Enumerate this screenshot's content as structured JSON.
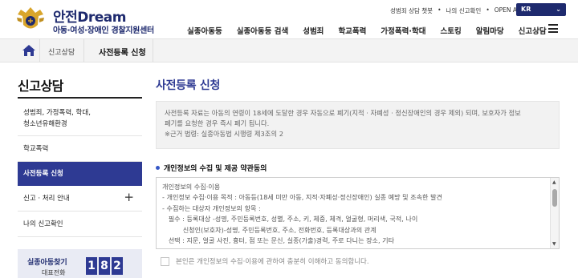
{
  "header": {
    "logo_title_a": "안전",
    "logo_title_b": "Dream",
    "logo_sub": "아동·여성·장애인 경찰지원센터",
    "util_links": [
      "성범죄 상담 챗봇",
      "나의 신고확인",
      "OPEN API"
    ],
    "language": "KR",
    "nav": [
      "실종아동등",
      "실종아동등 검색",
      "성범죄",
      "학교폭력",
      "가정폭력·학대",
      "스토킹",
      "알림마당",
      "신고상담"
    ]
  },
  "breadcrumb": {
    "level1": "신고상담",
    "level2": "사전등록 신청"
  },
  "sidebar": {
    "title": "신고상담",
    "items": [
      {
        "label_line1": "성범죄, 가정폭력, 학대,",
        "label_line2": "청소년유해환경"
      },
      {
        "label": "학교폭력"
      },
      {
        "label": "사전등록 신청"
      },
      {
        "label": "신고 · 처리 안내"
      },
      {
        "label": "나의 신고확인"
      }
    ],
    "call": {
      "label": "실종아동찾기",
      "sub": "대표전화",
      "digits": [
        "1",
        "8",
        "2"
      ]
    }
  },
  "main": {
    "title": "사전등록 신청",
    "info": {
      "line1": "사전등록 자료는 아동의 연령이 18세에 도달한 경우 자동으로 폐기(지적 · 자폐성 · 정신장애인의 경우 제외) 되며, 보호자가 정보",
      "line2": "폐기를 요청한 경우 즉시 폐기 됩니다.",
      "line3": "※근거 법령: 실종아동법 시행령 제3조의 2"
    },
    "section_title": "개인정보의 수집 및 제공 약관동의",
    "terms": [
      "개인정보의 수집·이용",
      "- 개인정보 수집·이용 목적 : 아동등(18세 미만 아동, 지적·자폐성·정신장애인) 실종 예방 및 조속한 발견",
      "- 수집하는 대상자 개인정보의 항목 :",
      "   필수 : 등록대상 -성명, 주민등록번호, 성별, 주소, 키, 체중, 체격, 얼굴형, 머리색, 국적, 나이",
      "          신청인(보호자)-성명, 주민등록번호, 주소, 전화번호, 등록대상과의 관계",
      "   선택 : 지문, 얼굴 사진, 흉터, 점 또는 문신, 실종(가출)경력, 주로 다니는 장소, 기타"
    ],
    "agree_label": "본인은 개인정보의 수집·이용에 관하여 충분히 이해하고 동의합니다."
  }
}
